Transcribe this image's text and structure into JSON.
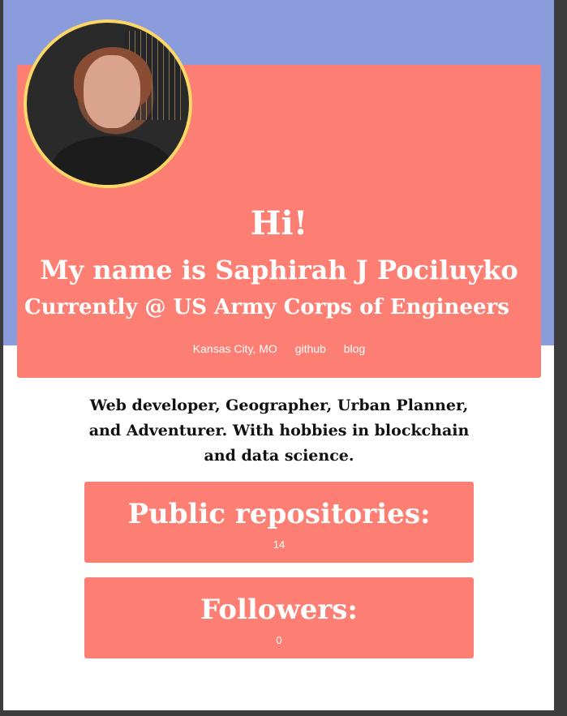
{
  "hero": {
    "greeting": "Hi!",
    "name_line": "My name is Saphirah J Pociluyko",
    "current_line": "Currently @ US Army Corps of Engineers",
    "location": "Kansas City, MO",
    "links": [
      "github",
      "blog"
    ]
  },
  "bio": {
    "text": "Web developer, Geographer, Urban Planner, and Adventurer. With hobbies in blockchain and data science."
  },
  "stats": [
    {
      "label": "Public repositories:",
      "value": "14"
    },
    {
      "label": "Followers:",
      "value": "0"
    }
  ],
  "colors": {
    "band": "#8a9cdb",
    "card": "#fd7e73",
    "avatar_ring": "#fbd766"
  }
}
